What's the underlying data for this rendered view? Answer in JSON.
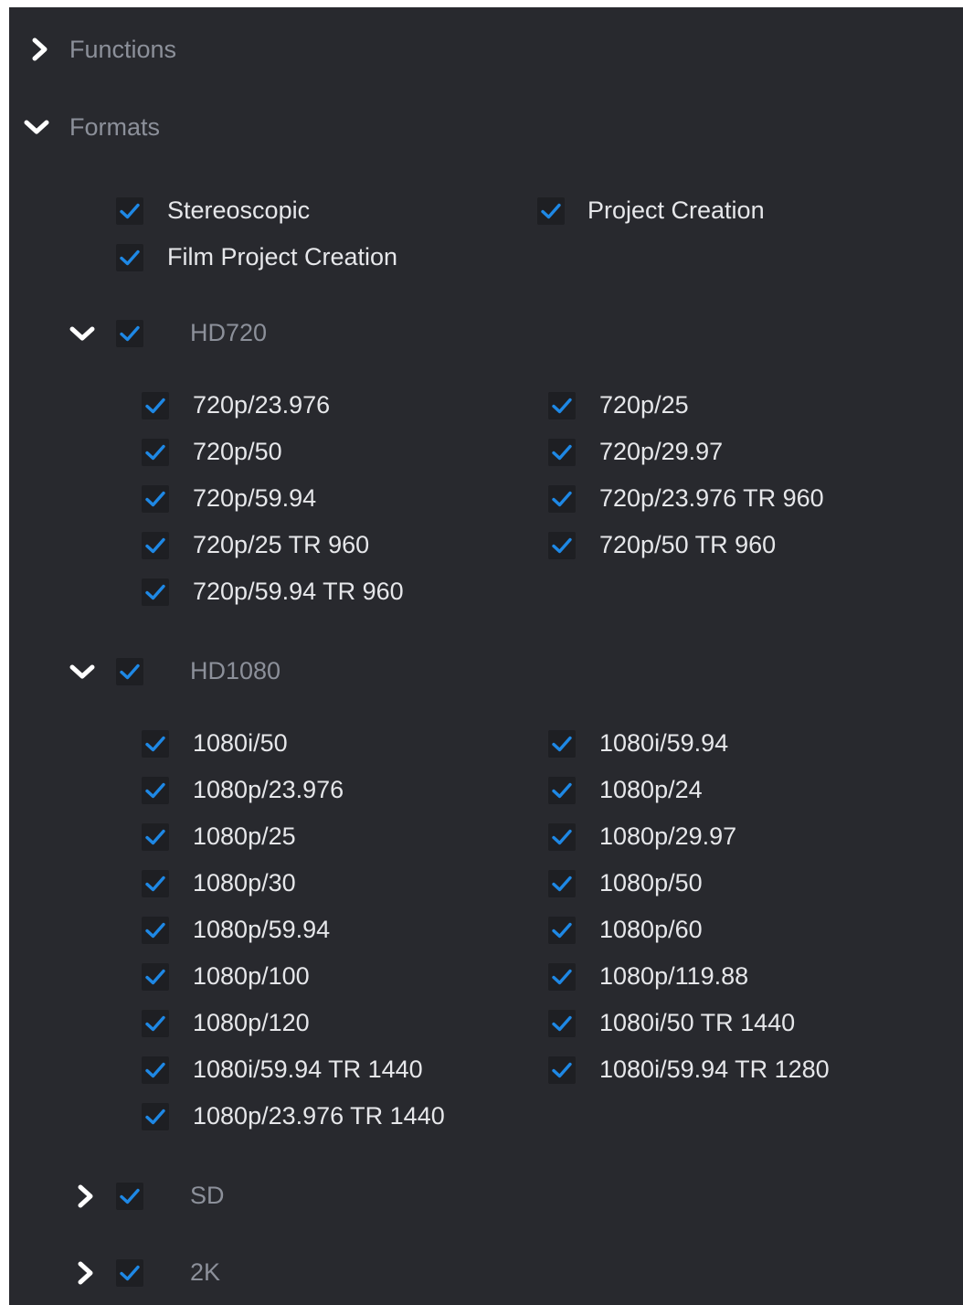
{
  "colors": {
    "panel_bg": "#28292e",
    "checkbox_bg": "#1e1f23",
    "check": "#1e88e5",
    "label": "#e6e7ea",
    "section_label": "#8c909a"
  },
  "icons": {
    "expanded": "chevron-down-icon",
    "collapsed": "chevron-right-icon",
    "checked": "checkmark-icon"
  },
  "functions": {
    "label": "Functions",
    "expanded": false
  },
  "formats": {
    "label": "Formats",
    "expanded": true,
    "top_options": [
      {
        "label": "Stereoscopic",
        "checked": true
      },
      {
        "label": "Project Creation",
        "checked": true
      },
      {
        "label": "Film Project Creation",
        "checked": true
      }
    ],
    "groups": [
      {
        "label": "HD720",
        "expanded": true,
        "checked": true,
        "items": [
          {
            "label": "720p/23.976",
            "checked": true
          },
          {
            "label": "720p/25",
            "checked": true
          },
          {
            "label": "720p/50",
            "checked": true
          },
          {
            "label": "720p/29.97",
            "checked": true
          },
          {
            "label": "720p/59.94",
            "checked": true
          },
          {
            "label": "720p/23.976 TR 960",
            "checked": true
          },
          {
            "label": "720p/25 TR 960",
            "checked": true
          },
          {
            "label": "720p/50 TR 960",
            "checked": true
          },
          {
            "label": "720p/59.94 TR 960",
            "checked": true
          }
        ]
      },
      {
        "label": "HD1080",
        "expanded": true,
        "checked": true,
        "items": [
          {
            "label": "1080i/50",
            "checked": true
          },
          {
            "label": "1080i/59.94",
            "checked": true
          },
          {
            "label": "1080p/23.976",
            "checked": true
          },
          {
            "label": "1080p/24",
            "checked": true
          },
          {
            "label": "1080p/25",
            "checked": true
          },
          {
            "label": "1080p/29.97",
            "checked": true
          },
          {
            "label": "1080p/30",
            "checked": true
          },
          {
            "label": "1080p/50",
            "checked": true
          },
          {
            "label": "1080p/59.94",
            "checked": true
          },
          {
            "label": "1080p/60",
            "checked": true
          },
          {
            "label": "1080p/100",
            "checked": true
          },
          {
            "label": "1080p/119.88",
            "checked": true
          },
          {
            "label": "1080p/120",
            "checked": true
          },
          {
            "label": "1080i/50 TR 1440",
            "checked": true
          },
          {
            "label": "1080i/59.94 TR 1440",
            "checked": true
          },
          {
            "label": "1080i/59.94 TR 1280",
            "checked": true
          },
          {
            "label": "1080p/23.976 TR 1440",
            "checked": true
          }
        ]
      },
      {
        "label": "SD",
        "expanded": false,
        "checked": true,
        "items": []
      },
      {
        "label": "2K",
        "expanded": false,
        "checked": true,
        "items": []
      }
    ]
  }
}
